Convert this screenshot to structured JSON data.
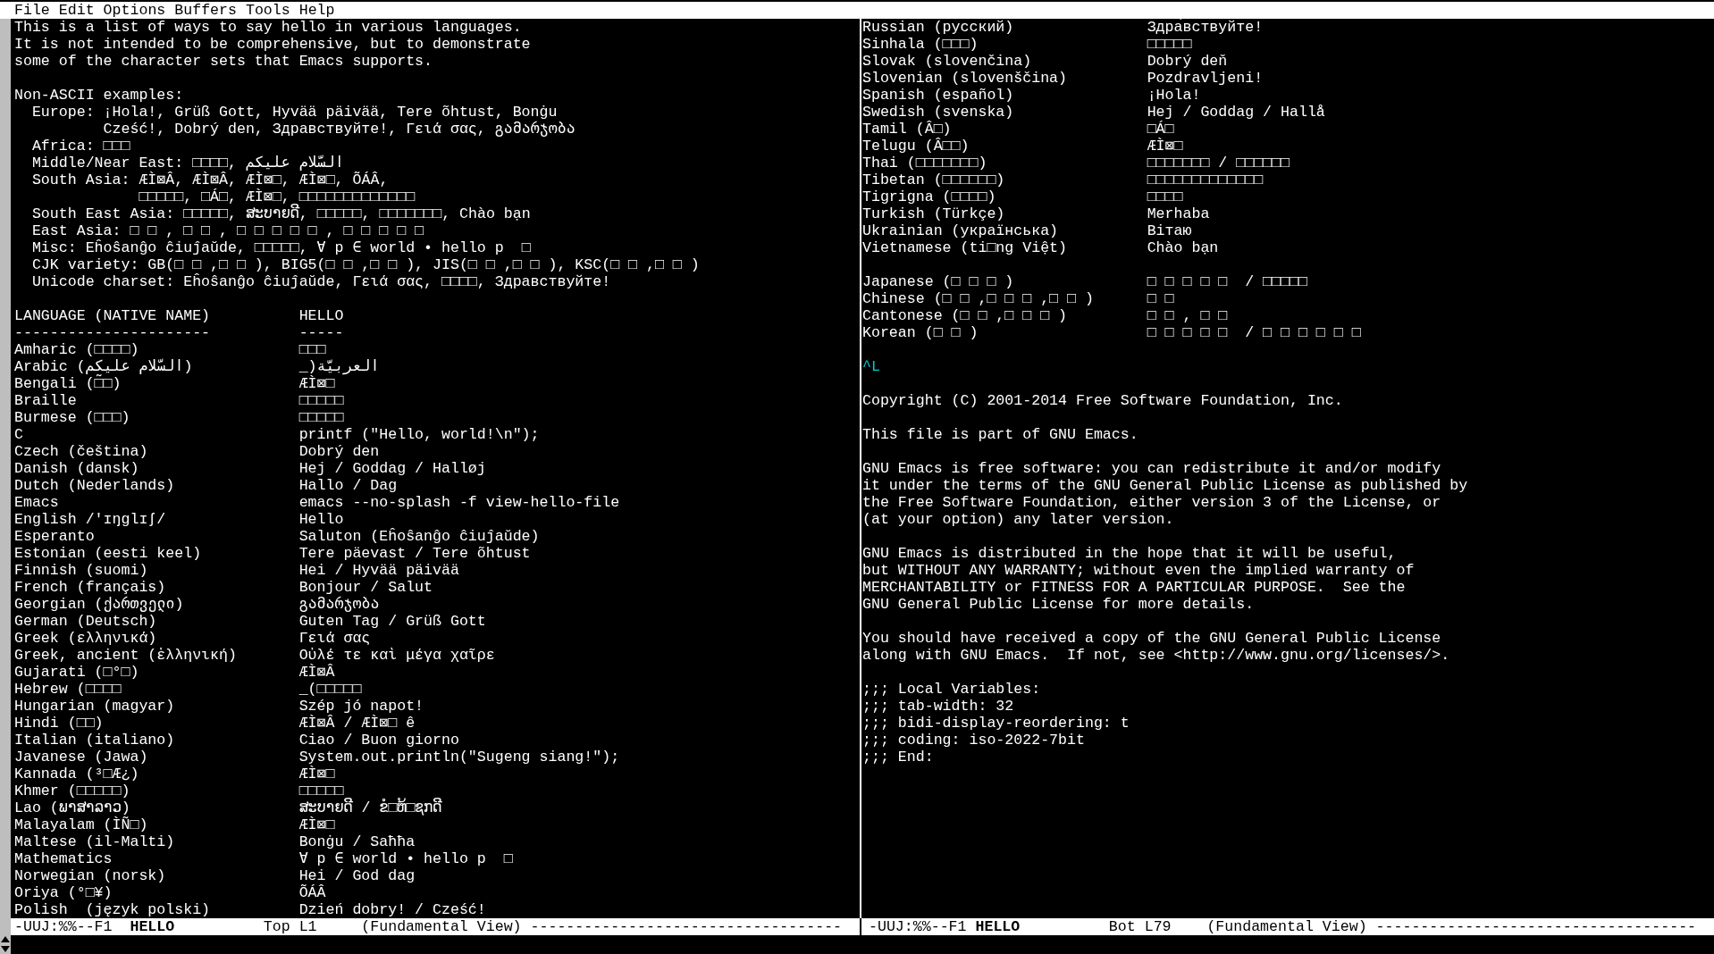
{
  "menu": [
    "File",
    "Edit",
    "Options",
    "Buffers",
    "Tools",
    "Help"
  ],
  "left_pane": {
    "blocks": [
      {
        "kind": "paragraph",
        "lines": [
          "This is a list of ways to say hello in various languages.",
          "It is not intended to be comprehensive, but to demonstrate",
          "some of the character sets that Emacs supports."
        ]
      },
      {
        "kind": "examples",
        "heading": "Non-ASCII examples:",
        "items": [
          {
            "label": "Europe:",
            "lines": [
              "¡Hola!, Grüß Gott, Hyvää päivää, Tere õhtust, Bonġu",
              "Cześć!, Dobrý den, Здравствуйте!, Γειά σας, გამარჯობა"
            ]
          },
          {
            "label": "Africa:",
            "lines": [
              "□□□"
            ]
          },
          {
            "label": "Middle/Near East:",
            "lines": [
              "□□□□, السّلام عليكم"
            ]
          },
          {
            "label": "South Asia:",
            "lines": [
              "ÆÌ⊠Â, ÆÌ⊠Â, ÆÌ⊠□, ÆÌ⊠□, ÕÁÂ,",
              "□□□□□, □Á□, ÆÌ⊠□, □□□□□□□□□□□□□"
            ]
          },
          {
            "label": "South East Asia:",
            "lines": [
              "□□□□□, ສະບາຍດີ, □□□□□, □□□□□□□, Chào bạn"
            ]
          },
          {
            "label": "East Asia:",
            "lines": [
              "□ □ , □ □ , □ □ □ □ □ , □ □ □ □ □"
            ]
          },
          {
            "label": "Misc:",
            "lines": [
              "Eĥoŝanĝo ĉiuĵaŭde, □□□□□, ∀ p ∈ world • hello p  □"
            ]
          },
          {
            "label": "CJK variety:",
            "lines": [
              "GB(□ □ ,□ □ ), BIG5(□ □ ,□ □ ), JIS(□ □ ,□ □ ), KSC(□ □ ,□ □ )"
            ]
          },
          {
            "label": "Unicode charset:",
            "lines": [
              "Eĥoŝanĝo ĉiuĵaŭde, Γειά σας, □□□□, Здравствуйте!"
            ]
          }
        ]
      },
      {
        "kind": "table",
        "header": {
          "language": "LANGUAGE (NATIVE NAME)",
          "hello": "HELLO"
        },
        "rule": {
          "language": "----------------------",
          "hello": "-----"
        },
        "rows": [
          {
            "language": "Amharic (□□□□)",
            "hello": "□□□"
          },
          {
            "language": "Arabic (السّلام عليكم)",
            "hello": "_)العربيّة"
          },
          {
            "language": "Bengali (□̃□)",
            "hello": "ÆÌ⊠□"
          },
          {
            "language": "Braille",
            "hello": "□□□□□"
          },
          {
            "language": "Burmese (□□□)",
            "hello": "□□□□□"
          },
          {
            "language": "C",
            "hello": "printf (\"Hello, world!\\n\");"
          },
          {
            "language": "Czech (čeština)",
            "hello": "Dobrý den"
          },
          {
            "language": "Danish (dansk)",
            "hello": "Hej / Goddag / Halløj"
          },
          {
            "language": "Dutch (Nederlands)",
            "hello": "Hallo / Dag"
          },
          {
            "language": "Emacs",
            "hello": "emacs --no-splash -f view-hello-file"
          },
          {
            "language": "English /'ɪŋglɪʃ/",
            "hello": "Hello"
          },
          {
            "language": "Esperanto",
            "hello": "Saluton (Eĥoŝanĝo ĉiuĵaŭde)"
          },
          {
            "language": "Estonian (eesti keel)",
            "hello": "Tere päevast / Tere õhtust"
          },
          {
            "language": "Finnish (suomi)",
            "hello": "Hei / Hyvää päivää"
          },
          {
            "language": "French (français)",
            "hello": "Bonjour / Salut"
          },
          {
            "language": "Georgian (ქართველი)",
            "hello": "გამარჯობა"
          },
          {
            "language": "German (Deutsch)",
            "hello": "Guten Tag / Grüß Gott"
          },
          {
            "language": "Greek (ελληνικά)",
            "hello": "Γειά σας"
          },
          {
            "language": "Greek, ancient (ἑλληνική)",
            "hello": "Οὐλέ τε καὶ μέγα χαῖρε"
          },
          {
            "language": "Gujarati (□°□)",
            "hello": "ÆÌ⊠Â"
          },
          {
            "language": "Hebrew (□□□□",
            "hello": "_(□□□□□"
          },
          {
            "language": "Hungarian (magyar)",
            "hello": "Szép jó napot!"
          },
          {
            "language": "Hindi (□□)",
            "hello": "ÆÌ⊠Â / ÆÌ⊠□ ê"
          },
          {
            "language": "Italian (italiano)",
            "hello": "Ciao / Buon giorno"
          },
          {
            "language": "Javanese (Jawa)",
            "hello": "System.out.println(\"Sugeng siang!\");"
          },
          {
            "language": "Kannada (³□Æ¿)",
            "hello": "ÆÌ⊠□"
          },
          {
            "language": "Khmer (□□□□□)",
            "hello": "□□□□□"
          },
          {
            "language": "Lao (ພາສາລາວ)",
            "hello": "ສະບາຍດີ / ຂໍ□ຫ້□ຊກດີ"
          },
          {
            "language": "Malayalam (ÌÑ□)",
            "hello": "ÆÌ⊠□"
          },
          {
            "language": "Maltese (il-Malti)",
            "hello": "Bonġu / Saħħa"
          },
          {
            "language": "Mathematics",
            "hello": "∀ p ∈ world • hello p  □"
          },
          {
            "language": "Norwegian (norsk)",
            "hello": "Hei / God dag"
          },
          {
            "language": "Oriya (°□¥)",
            "hello": "ÕÁÂ"
          },
          {
            "language": "Polish  (język polski)",
            "hello": "Dzień dobry! / Cześć!"
          }
        ]
      }
    ]
  },
  "right_pane": {
    "blocks": [
      {
        "kind": "table",
        "rows": [
          {
            "language": "Russian (русский)",
            "hello": "Здра́вствуйте!"
          },
          {
            "language": "Sinhala (□□□)",
            "hello": "□□□□□"
          },
          {
            "language": "Slovak (slovenčina)",
            "hello": "Dobrý deň"
          },
          {
            "language": "Slovenian (slovenščina)",
            "hello": "Pozdravljeni!"
          },
          {
            "language": "Spanish (español)",
            "hello": "¡Hola!"
          },
          {
            "language": "Swedish (svenska)",
            "hello": "Hej / Goddag / Hallå"
          },
          {
            "language": "Tamil (Â□)",
            "hello": "□Á□"
          },
          {
            "language": "Telugu (Â□□)",
            "hello": "ÆÌ⊠□"
          },
          {
            "language": "Thai (□□□□□□□)",
            "hello": "□□□□□□□ / □□□□□□"
          },
          {
            "language": "Tibetan (□□□□□□)",
            "hello": "□□□□□□□□□□□□□"
          },
          {
            "language": "Tigrigna (□□□□)",
            "hello": "□□□□"
          },
          {
            "language": "Turkish (Türkçe)",
            "hello": "Merhaba"
          },
          {
            "language": "Ukrainian (українська)",
            "hello": "Вітаю"
          },
          {
            "language": "Vietnamese (ti□ng Việt)",
            "hello": "Chào bạn"
          }
        ]
      },
      {
        "kind": "table",
        "rows": [
          {
            "language": "Japanese (□ □ □ )",
            "hello": "□ □ □ □ □  / □□□□□"
          },
          {
            "language": "Chinese (□ □ ,□ □ □ ,□ □ )",
            "hello": "□ □"
          },
          {
            "language": "Cantonese (□ □ ,□ □ □ )",
            "hello": "□ □ , □ □"
          },
          {
            "language": "Korean (□ □ )",
            "hello": "□ □ □ □ □  / □ □ □ □ □ □"
          }
        ]
      },
      {
        "kind": "formfeed",
        "text": "^L"
      },
      {
        "kind": "paragraph",
        "lines": [
          "Copyright (C) 2001-2014 Free Software Foundation, Inc."
        ]
      },
      {
        "kind": "paragraph",
        "lines": [
          "This file is part of GNU Emacs."
        ]
      },
      {
        "kind": "paragraph",
        "lines": [
          "GNU Emacs is free software: you can redistribute it and/or modify",
          "it under the terms of the GNU General Public License as published by",
          "the Free Software Foundation, either version 3 of the License, or",
          "(at your option) any later version."
        ]
      },
      {
        "kind": "paragraph",
        "lines": [
          "GNU Emacs is distributed in the hope that it will be useful,",
          "but WITHOUT ANY WARRANTY; without even the implied warranty of",
          "MERCHANTABILITY or FITNESS FOR A PARTICULAR PURPOSE.  See the",
          "GNU General Public License for more details."
        ]
      },
      {
        "kind": "paragraph",
        "lines": [
          "You should have received a copy of the GNU General Public License",
          "along with GNU Emacs.  If not, see <http://www.gnu.org/licenses/>."
        ]
      },
      {
        "kind": "paragraph",
        "lines": [
          ";;; Local Variables:",
          ";;; tab-width: 32",
          ";;; bidi-display-reordering: t",
          ";;; coding: iso-2022-7bit",
          ";;; End:"
        ]
      }
    ]
  },
  "mode_lines": [
    {
      "status": "-UUJ:%%--F1",
      "buffer": "HELLO",
      "position": "Top L1",
      "mode": "(Fundamental View)",
      "fill": "-----------------------------------"
    },
    {
      "status": "-UUJ:%%--F1",
      "buffer": "HELLO",
      "position": "Bot L79",
      "mode": "(Fundamental View)",
      "fill": "------------------------------------"
    }
  ]
}
